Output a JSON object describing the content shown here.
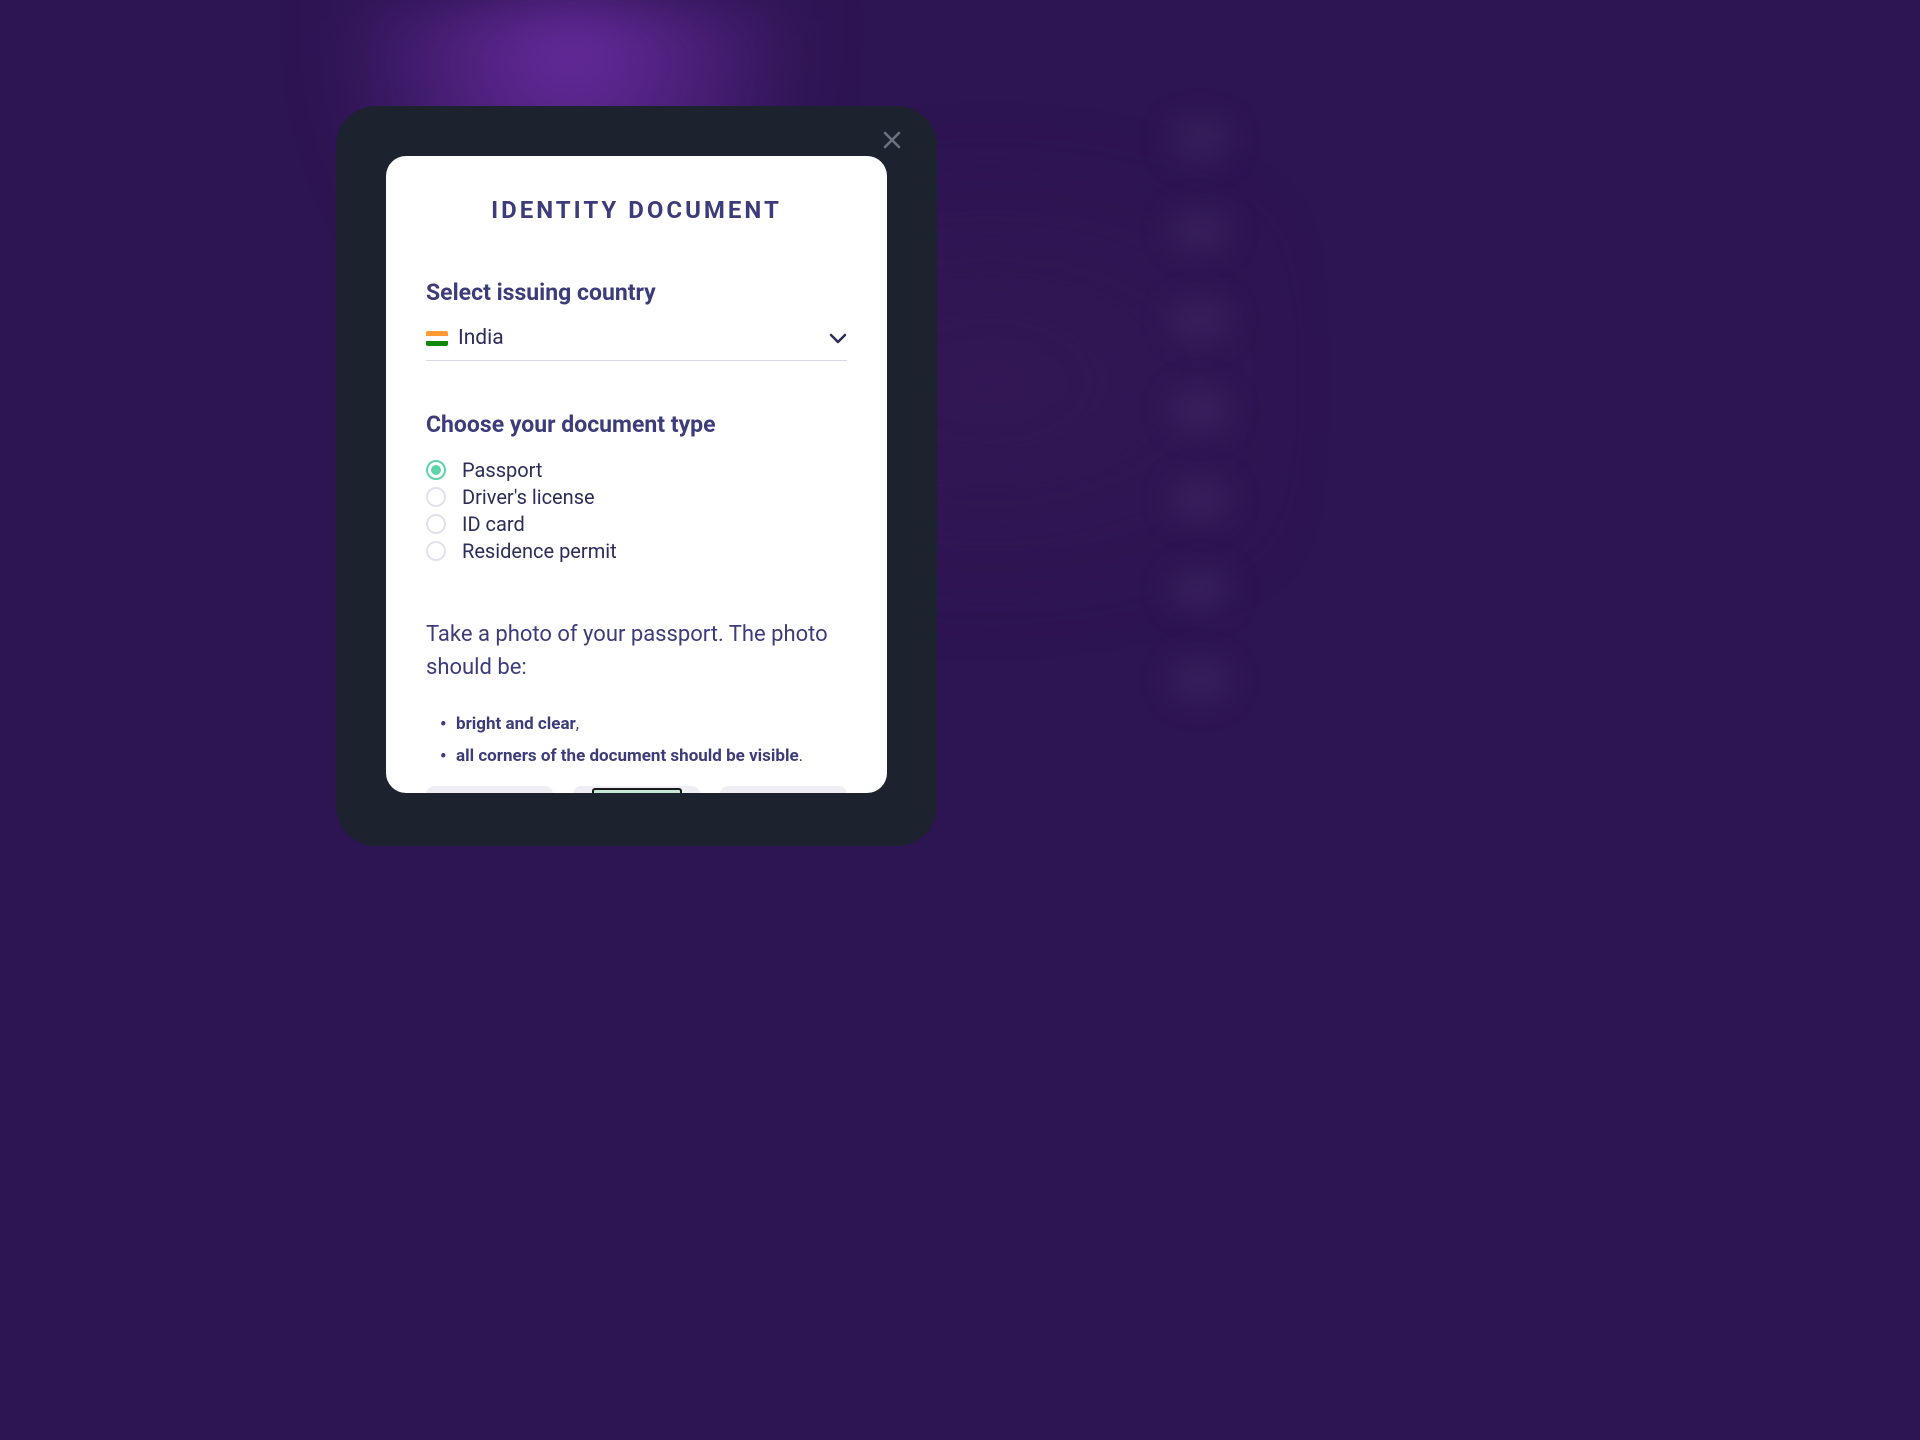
{
  "modal": {
    "title": "IDENTITY DOCUMENT",
    "country_section": {
      "heading": "Select issuing country",
      "selected_country": "India",
      "flag_colors": [
        "#ff9933",
        "#ffffff",
        "#138808"
      ]
    },
    "document_section": {
      "heading": "Choose your document type",
      "options": [
        {
          "label": "Passport",
          "selected": true
        },
        {
          "label": "Driver's license",
          "selected": false
        },
        {
          "label": "ID card",
          "selected": false
        },
        {
          "label": "Residence permit",
          "selected": false
        }
      ]
    },
    "instructions": {
      "lead_text": "Take a photo of your passport. The photo should be:",
      "bullets": [
        {
          "bold": "bright and clear",
          "tail": ","
        },
        {
          "bold": "all corners of the document should be visible",
          "tail": "."
        }
      ]
    }
  }
}
